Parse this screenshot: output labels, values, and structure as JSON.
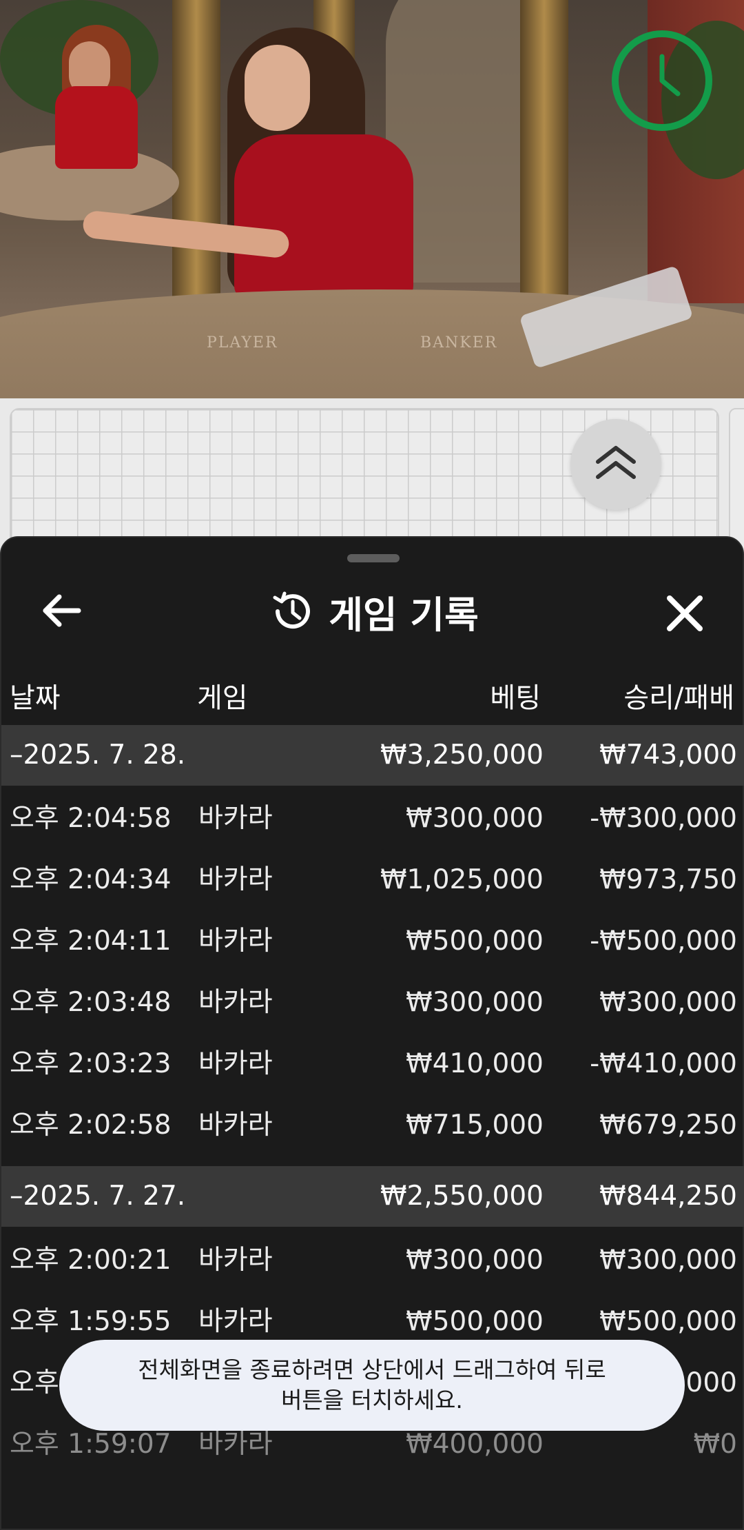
{
  "colors": {
    "timer": "#139c4a",
    "sheet_background": "#1b1b1b",
    "date_row_background": "#393939",
    "toast_background": "#edf0f8"
  },
  "video": {
    "table_player_label": "PLAYER",
    "table_banker_label": "BANKER"
  },
  "icons": {
    "timer": "timer-clock-icon",
    "expand": "double-chevron-up-icon",
    "back": "arrow-left-icon",
    "history": "history-icon",
    "close": "close-icon"
  },
  "sheet": {
    "title": "게임 기록",
    "columns": {
      "date": "날짜",
      "game": "게임",
      "bet": "베팅",
      "result": "승리/패배"
    }
  },
  "groups": [
    {
      "date_label": "–2025. 7. 28.",
      "total_bet": "₩3,250,000",
      "total_result": "₩743,000",
      "rows": [
        {
          "time": "오후 2:04:58",
          "game": "바카라",
          "bet": "₩300,000",
          "result": "-₩300,000"
        },
        {
          "time": "오후 2:04:34",
          "game": "바카라",
          "bet": "₩1,025,000",
          "result": "₩973,750"
        },
        {
          "time": "오후 2:04:11",
          "game": "바카라",
          "bet": "₩500,000",
          "result": "-₩500,000"
        },
        {
          "time": "오후 2:03:48",
          "game": "바카라",
          "bet": "₩300,000",
          "result": "₩300,000"
        },
        {
          "time": "오후 2:03:23",
          "game": "바카라",
          "bet": "₩410,000",
          "result": "-₩410,000"
        },
        {
          "time": "오후 2:02:58",
          "game": "바카라",
          "bet": "₩715,000",
          "result": "₩679,250"
        }
      ]
    },
    {
      "date_label": "–2025. 7. 27.",
      "total_bet": "₩2,550,000",
      "total_result": "₩844,250",
      "rows": [
        {
          "time": "오후 2:00:21",
          "game": "바카라",
          "bet": "₩300,000",
          "result": "₩300,000"
        },
        {
          "time": "오후 1:59:55",
          "game": "바카라",
          "bet": "₩500,000",
          "result": "₩500,000"
        },
        {
          "time": "오후",
          "game": "",
          "bet": "",
          "result": "000"
        },
        {
          "time": "오후 1:59:07",
          "game": "바카라",
          "bet": "₩400,000",
          "result": "₩0"
        }
      ]
    }
  ],
  "toast": {
    "line1": "전체화면을 종료하려면 상단에서 드래그하여 뒤로",
    "line2": "버튼을 터치하세요."
  }
}
